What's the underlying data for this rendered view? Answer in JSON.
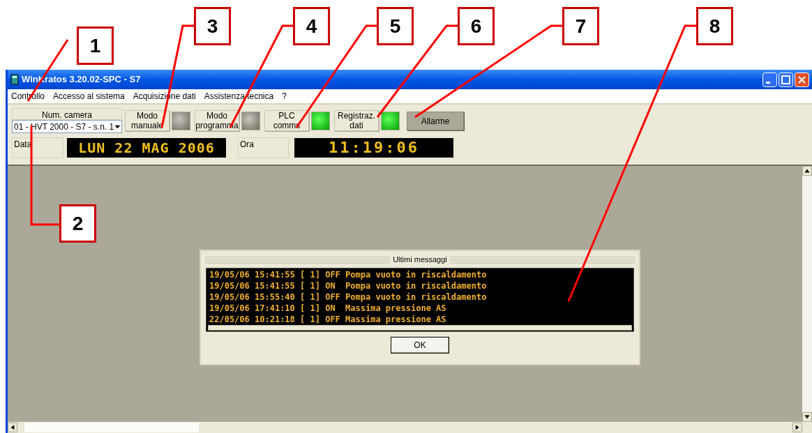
{
  "window": {
    "title": "WinKratos 3.20.02-SPC - S7"
  },
  "menu": [
    {
      "label": "Controllo"
    },
    {
      "label": "Accesso al sistema"
    },
    {
      "label": "Acquisizione dati"
    },
    {
      "label": "Assistenza tecnica"
    },
    {
      "label": "?"
    }
  ],
  "camera": {
    "label": "Num. camera",
    "value": "01 - HVT 2000 - S7 - s.n. 1"
  },
  "mode_buttons": [
    {
      "lines": [
        "Modo",
        "manuale"
      ],
      "on": false
    },
    {
      "lines": [
        "Modo",
        "programma"
      ],
      "on": false
    },
    {
      "lines": [
        "PLC",
        "comms"
      ],
      "on": true
    },
    {
      "lines": [
        "Registraz.",
        "dati"
      ],
      "on": true
    }
  ],
  "alarm_button": {
    "label": "Allarme"
  },
  "date": {
    "label": "Data",
    "value": "LUN 22 MAG 2006"
  },
  "time": {
    "label": "Ora",
    "value": "11:19:06"
  },
  "dialog": {
    "title": "Ultimi messaggi",
    "messages": [
      "19/05/06 15:41:55 [ 1] OFF Pompa vuoto in riscaldamento",
      "19/05/06 15:41:55 [ 1] ON  Pompa vuoto in riscaldamento",
      "19/05/06 15:55:40 [ 1] OFF Pompa vuoto in riscaldamento",
      "19/05/06 17:41:10 [ 1] ON  Massima pressione AS",
      "22/05/06 10:21:18 [ 1] OFF Massima pressione AS"
    ],
    "button": "OK"
  },
  "callouts": [
    {
      "number": "1"
    },
    {
      "number": "2"
    },
    {
      "number": "3"
    },
    {
      "number": "4"
    },
    {
      "number": "5"
    },
    {
      "number": "6"
    },
    {
      "number": "7"
    },
    {
      "number": "8"
    }
  ]
}
